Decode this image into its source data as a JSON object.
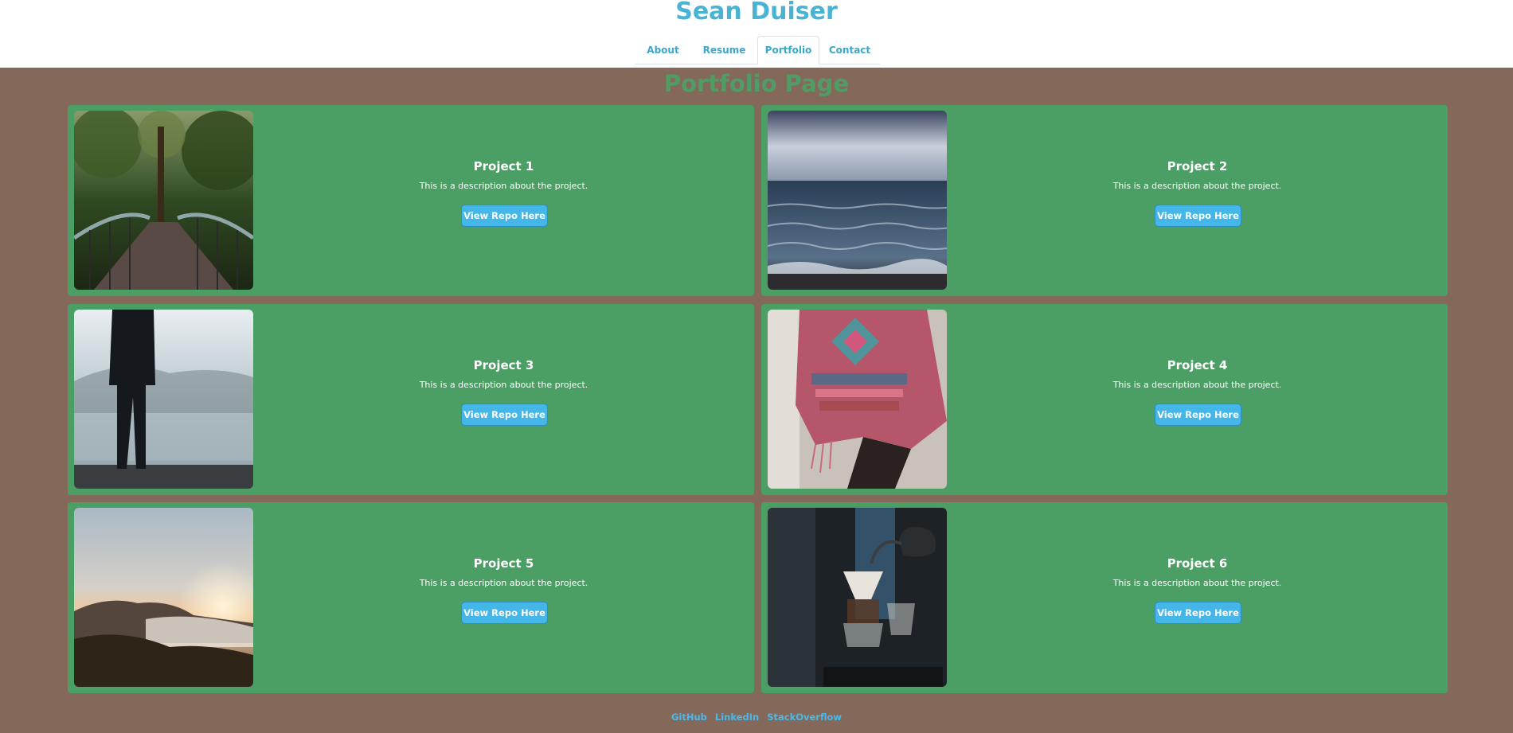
{
  "site": {
    "title": "Sean Duiser"
  },
  "nav": {
    "items": [
      {
        "label": "About"
      },
      {
        "label": "Resume"
      },
      {
        "label": "Portfolio",
        "active": true
      },
      {
        "label": "Contact"
      }
    ]
  },
  "page": {
    "heading": "Portfolio Page"
  },
  "projects": [
    {
      "title": "Project 1",
      "description": "This is a description about the project.",
      "button": "View Repo Here",
      "image": "forest-bridge-photo"
    },
    {
      "title": "Project 2",
      "description": "This is a description about the project.",
      "button": "View Repo Here",
      "image": "ocean-waves-photo"
    },
    {
      "title": "Project 3",
      "description": "This is a description about the project.",
      "button": "View Repo Here",
      "image": "person-at-lake-photo"
    },
    {
      "title": "Project 4",
      "description": "This is a description about the project.",
      "button": "View Repo Here",
      "image": "patterned-poncho-photo"
    },
    {
      "title": "Project 5",
      "description": "This is a description about the project.",
      "button": "View Repo Here",
      "image": "misty-sunset-photo"
    },
    {
      "title": "Project 6",
      "description": "This is a description about the project.",
      "button": "View Repo Here",
      "image": "coffee-pour-over-photo"
    }
  ],
  "footer": {
    "links": [
      {
        "label": "GitHub"
      },
      {
        "label": "LinkedIn"
      },
      {
        "label": "StackOverflow"
      }
    ]
  },
  "colors": {
    "page_background": "#84695a",
    "card_background": "#4b9e64",
    "accent_blue": "#4ab3d3",
    "button_blue": "#44b6e8",
    "heading_green": "#4f9d65"
  }
}
